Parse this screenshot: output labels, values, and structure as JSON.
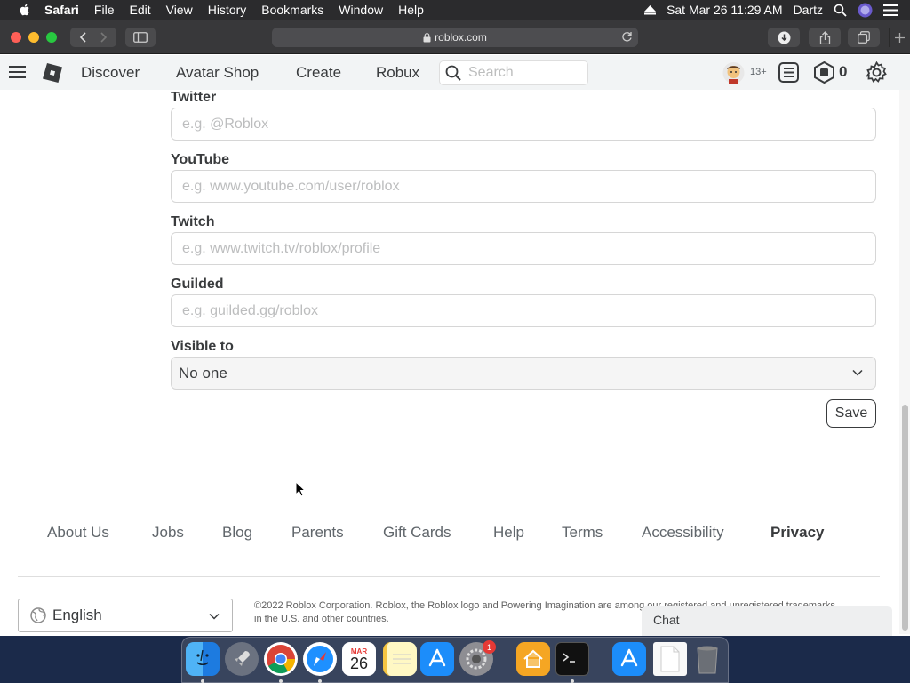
{
  "menubar": {
    "app": "Safari",
    "items": [
      "File",
      "Edit",
      "View",
      "History",
      "Bookmarks",
      "Window",
      "Help"
    ],
    "datetime": "Sat Mar 26  11:29 AM",
    "user": "Dartz"
  },
  "browser": {
    "url": "roblox.com"
  },
  "nav": {
    "links": [
      "Discover",
      "Avatar Shop",
      "Create",
      "Robux"
    ],
    "search_placeholder": "Search",
    "age_badge": "13+",
    "robux_count": "0"
  },
  "form": {
    "fields": [
      {
        "label": "Twitter",
        "placeholder": "e.g. @Roblox"
      },
      {
        "label": "YouTube",
        "placeholder": "e.g. www.youtube.com/user/roblox"
      },
      {
        "label": "Twitch",
        "placeholder": "e.g. www.twitch.tv/roblox/profile"
      },
      {
        "label": "Guilded",
        "placeholder": "e.g. guilded.gg/roblox"
      }
    ],
    "visible_label": "Visible to",
    "visible_value": "No one",
    "save_label": "Save"
  },
  "footer": {
    "links": [
      "About Us",
      "Jobs",
      "Blog",
      "Parents",
      "Gift Cards",
      "Help",
      "Terms",
      "Accessibility",
      "Privacy"
    ],
    "language": "English",
    "copyright": "©2022 Roblox Corporation. Roblox, the Roblox logo and Powering Imagination are among our registered and unregistered trademarks in the U.S. and other countries.",
    "chat_label": "Chat"
  },
  "dock": {
    "calendar_month": "MAR",
    "calendar_day": "26",
    "prefs_badge": "1"
  },
  "colors": {
    "nav_bg": "#f2f4f5",
    "text": "#393b3d",
    "safari_toolbar": "#38383a"
  }
}
